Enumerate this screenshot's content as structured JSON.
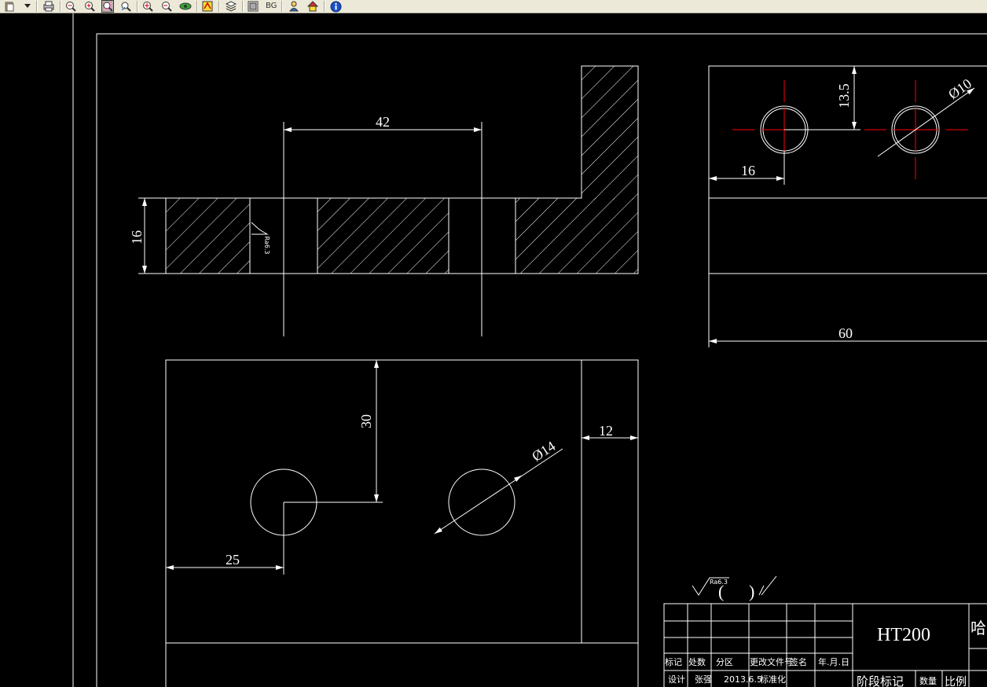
{
  "toolbar": {
    "icons": [
      "paste-icon",
      "dropdown-arrow-icon",
      "print-icon",
      "zoom-out-icon",
      "zoom-in-icon",
      "zoom-window-icon",
      "pan-icon",
      "zoom-extent-icon",
      "zoom-previous-icon",
      "view-3d-icon",
      "regen-icon",
      "layer-icon",
      "layout-icon",
      "background-icon",
      "person-icon",
      "home-icon",
      "info-icon"
    ],
    "bg_label": "BG"
  },
  "colors": {
    "canvas": "#000000",
    "line": "#ffffff",
    "centerline": "#ff0000",
    "toolbar": "#ece9d8"
  },
  "drawing": {
    "top_view_dims": {
      "hole_spacing": "42",
      "thickness": "16",
      "surface_finish_tag": "Ra6.3"
    },
    "side_view_dims": {
      "vertical_offset": "13.5",
      "hole_dia": "Ø10",
      "edge_offset": "16",
      "width": "60"
    },
    "front_view_dims": {
      "height": "30",
      "big_hole_dia": "Ø14",
      "width_right": "12",
      "left_offset": "25"
    },
    "roughness": {
      "ra_value": "Ra6.3",
      "open_paren": "(",
      "close_paren": ")"
    },
    "title_block": {
      "material": "HT200",
      "company_partial": "哈",
      "row_labels": [
        "标记",
        "处数",
        "分区",
        "更改文件号",
        "签名",
        "年.月.日"
      ],
      "design_label": "设计",
      "designer": "张强",
      "date": "2013.6.5",
      "standardize": "标准化",
      "stage_mark": "阶段标记",
      "quantity": "数量",
      "scale": "比例"
    }
  }
}
